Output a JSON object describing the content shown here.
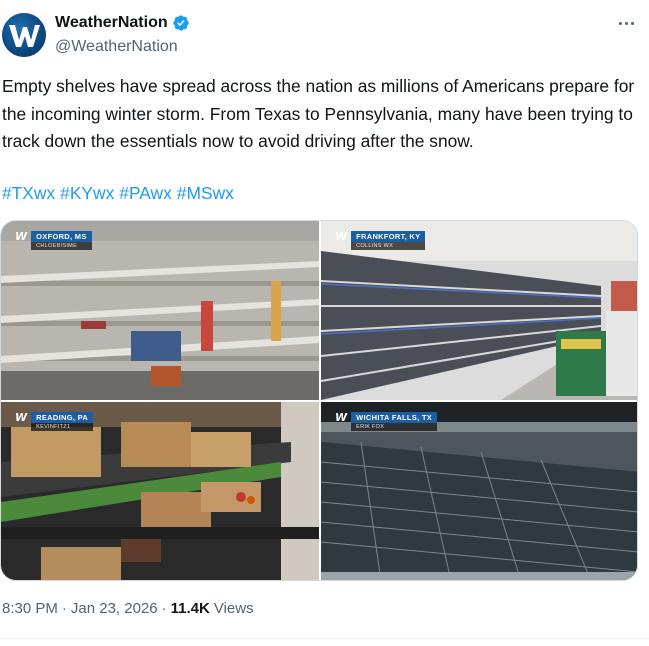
{
  "author": {
    "display_name": "WeatherNation",
    "handle": "@WeatherNation",
    "verified": true,
    "avatar_letter": "W",
    "verified_color": "#1d9bf0"
  },
  "tweet": {
    "text": "Empty shelves have spread across the nation as millions of Americans prepare for the incoming winter storm. From Texas to Pennsylvania, many have been trying to track down the essentials now to avoid driving after the snow.",
    "hashtags": [
      "#TXwx",
      "#KYwx",
      "#PAwx",
      "#MSwx"
    ],
    "hashtag_color": "#1d9bf0"
  },
  "media": [
    {
      "location": "OXFORD, MS",
      "credit": "CHLOEBISIME"
    },
    {
      "location": "FRANKFORT, KY",
      "credit": "COLLINS WX"
    },
    {
      "location": "READING, PA",
      "credit": "KEVINFITZ1"
    },
    {
      "location": "WICHITA FALLS, TX",
      "credit": "ERIK FOX"
    }
  ],
  "footer": {
    "time": "8:30 PM",
    "separator": "·",
    "date": "Jan 23, 2026",
    "views_count": "11.4K",
    "views_label": "Views"
  },
  "icons": {
    "more": "more-horizontal-icon",
    "verified": "verified-badge-icon"
  }
}
